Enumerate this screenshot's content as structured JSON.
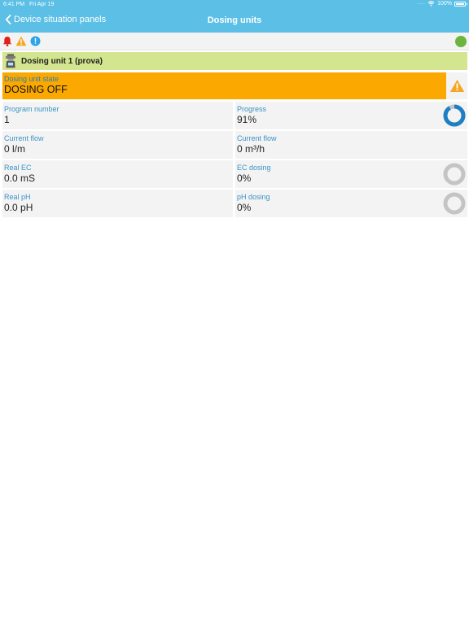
{
  "status_bar": {
    "time": "6:41 PM",
    "date": "Fri Apr 19",
    "battery": "100%"
  },
  "nav": {
    "back_label": "Device situation panels",
    "title": "Dosing units"
  },
  "unit": {
    "title": "Dosing unit 1 (prova)"
  },
  "state": {
    "label": "Dosing unit state",
    "value": "DOSING OFF"
  },
  "fields": {
    "program_number": {
      "label": "Program number",
      "value": "1"
    },
    "progress": {
      "label": "Progress",
      "value": "91%",
      "fraction": 0.91
    },
    "current_flow_l": {
      "label": "Current flow",
      "value": "0 l/m"
    },
    "current_flow_m3": {
      "label": "Current flow",
      "value": "0 m³/h"
    },
    "real_ec": {
      "label": "Real EC",
      "value": "0.0 mS"
    },
    "ec_dosing": {
      "label": "EC dosing",
      "value": "0%",
      "fraction": 0
    },
    "real_ph": {
      "label": "Real pH",
      "value": "0.0 pH"
    },
    "ph_dosing": {
      "label": "pH dosing",
      "value": "0%",
      "fraction": 0
    }
  },
  "colors": {
    "header": "#5bbfe6",
    "unit_bar": "#d3e58e",
    "state_bg": "#fba900",
    "label_blue": "#3a93c8",
    "ring_active": "#1e7fc4",
    "ring_inactive": "#c4c4c4",
    "online_dot": "#6ab43f"
  },
  "icons": [
    "chevron-left-icon",
    "wifi-icon",
    "battery-icon",
    "bell-icon",
    "warning-icon",
    "info-icon",
    "status-online-icon",
    "dosing-unit-icon"
  ]
}
